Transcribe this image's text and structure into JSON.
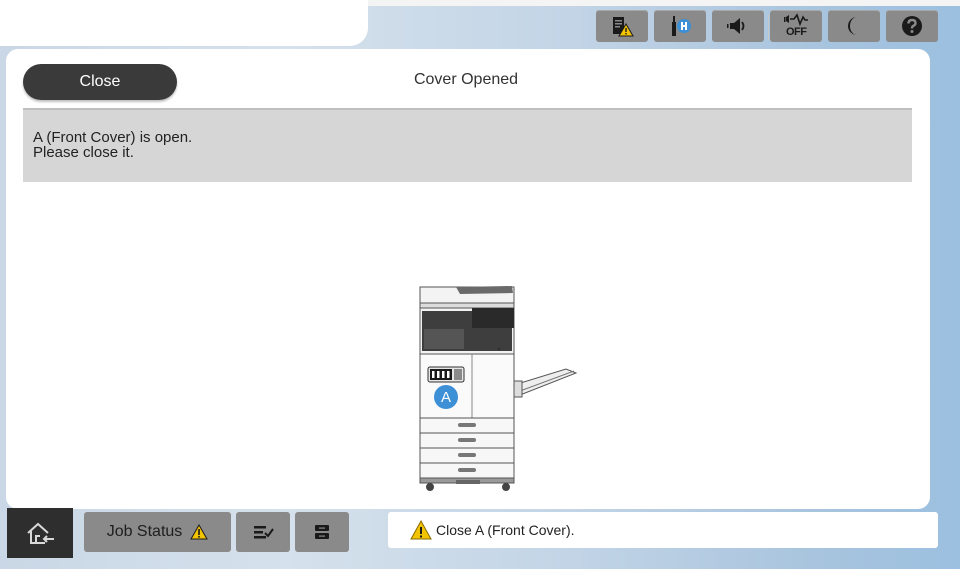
{
  "header": {
    "icons": [
      "paper-warning-icon",
      "network-status-icon",
      "volume-icon",
      "quiet-mode-off-icon",
      "sleep-moon-icon",
      "help-icon"
    ],
    "quiet_label": "OFF"
  },
  "dialog": {
    "close_label": "Close",
    "title": "Cover Opened",
    "message_line1": "A (Front Cover) is open.",
    "message_line2": "Please close it.",
    "callout_letter": "A"
  },
  "footer": {
    "job_status_label": "Job Status",
    "status_message": "Close A (Front Cover)."
  },
  "colors": {
    "accent_blue": "#3d8fd6",
    "warning_yellow": "#f2c300",
    "button_gray": "#8a8a8a",
    "dark_button": "#3a3a3a"
  }
}
